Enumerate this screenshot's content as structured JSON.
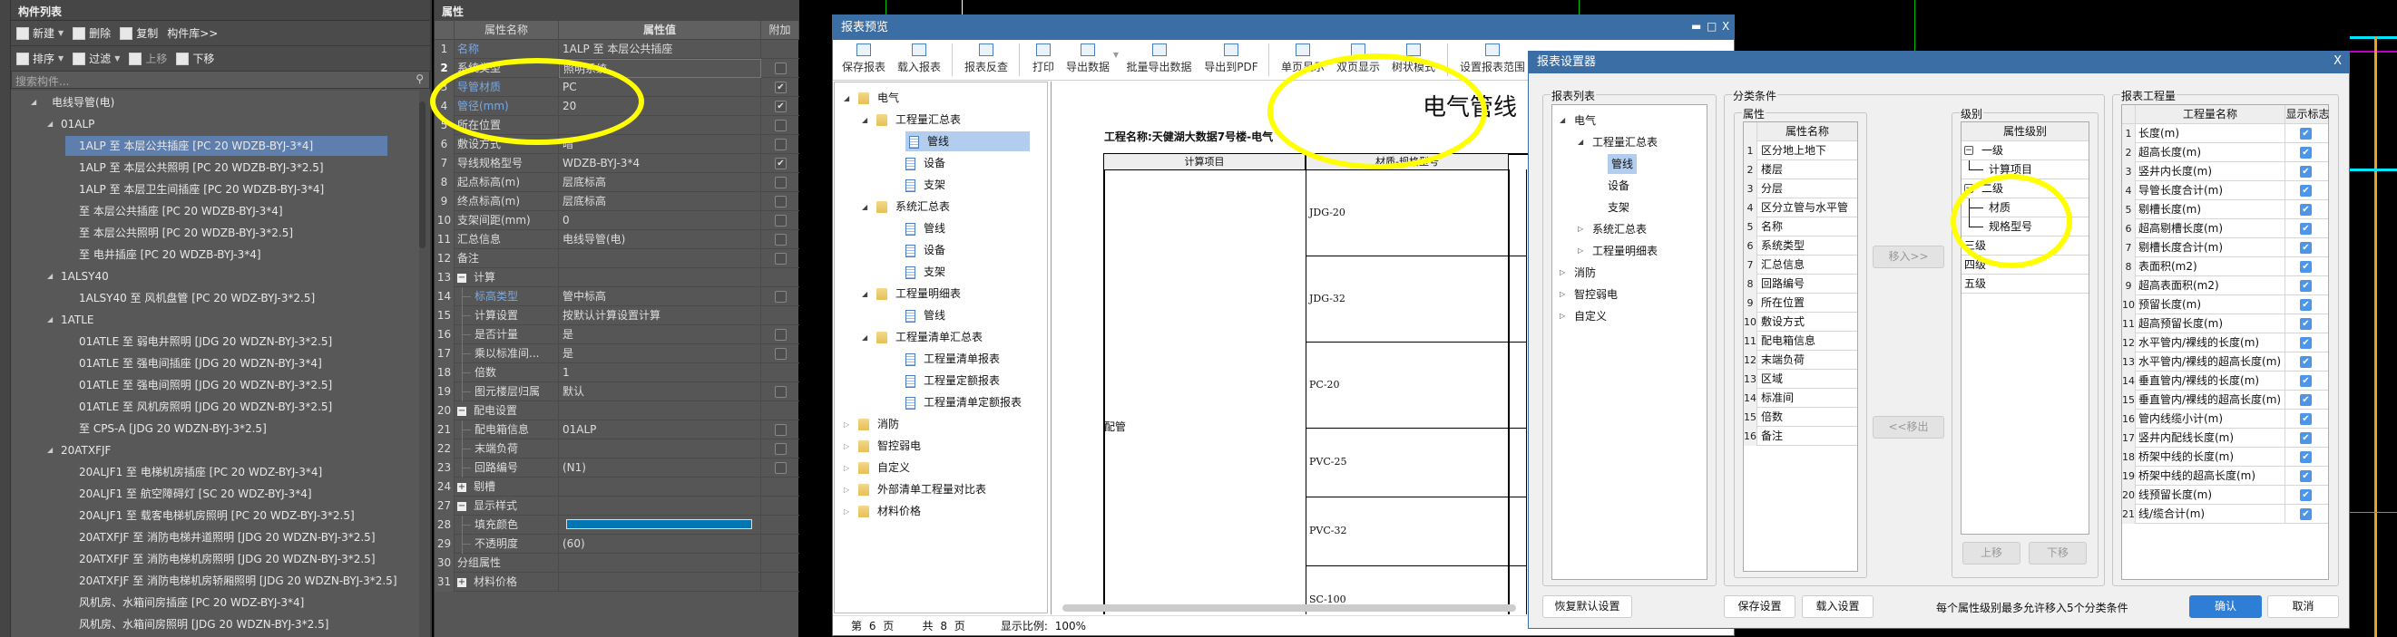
{
  "component_panel": {
    "title": "构件列表",
    "toolbar1": [
      {
        "label": "新建",
        "icon": "new-doc-icon",
        "dropdown": true
      },
      {
        "label": "删除",
        "icon": "delete-icon"
      },
      {
        "label": "复制",
        "icon": "copy-icon"
      },
      {
        "label": "构件库>>"
      }
    ],
    "toolbar2": [
      {
        "label": "排序",
        "icon": "sort-icon",
        "dropdown": true
      },
      {
        "label": "过滤",
        "icon": "filter-icon",
        "dropdown": true
      },
      {
        "label": "上移",
        "icon": "move-up-icon",
        "disabled": true
      },
      {
        "label": "下移",
        "icon": "move-down-icon"
      }
    ],
    "search_placeholder": "搜索构件...",
    "tree": [
      {
        "level": 0,
        "label": "电线导管(电)"
      },
      {
        "level": 1,
        "label": "01ALP"
      },
      {
        "level": 2,
        "label": "1ALP 至 本层公共插座 [PC 20 WDZB-BYJ-3*4]",
        "selected": true
      },
      {
        "level": 2,
        "label": "1ALP 至 本层公共照明 [PC 20 WDZB-BYJ-3*2.5]"
      },
      {
        "level": 2,
        "label": "1ALP 至 本层卫生间插座 [PC 20 WDZB-BYJ-3*4]"
      },
      {
        "level": 2,
        "label": "至 本层公共插座 [PC 20 WDZB-BYJ-3*4]"
      },
      {
        "level": 2,
        "label": "至 本层公共照明 [PC 20 WDZB-BYJ-3*2.5]"
      },
      {
        "level": 2,
        "label": "至 电井插座 [PC 20 WDZB-BYJ-3*4]"
      },
      {
        "level": 1,
        "label": "1ALSY40"
      },
      {
        "level": 2,
        "label": "1ALSY40 至 风机盘管 [PC 20 WDZ-BYJ-3*2.5]"
      },
      {
        "level": 1,
        "label": "1ATLE"
      },
      {
        "level": 2,
        "label": "01ATLE 至 弱电井照明 [JDG 20 WDZN-BYJ-3*2.5]"
      },
      {
        "level": 2,
        "label": "01ATLE 至 强电间插座 [JDG 20 WDZN-BYJ-3*4]"
      },
      {
        "level": 2,
        "label": "01ATLE 至 强电间照明 [JDG 20 WDZN-BYJ-3*2.5]"
      },
      {
        "level": 2,
        "label": "01ATLE 至 风机房照明 [JDG 20 WDZN-BYJ-3*2.5]"
      },
      {
        "level": 2,
        "label": "至 CPS-A [JDG 20 WDZN-BYJ-3*2.5]"
      },
      {
        "level": 1,
        "label": "20ATXFJF"
      },
      {
        "level": 2,
        "label": "20ALJF1 至 电梯机房插座 [PC 20 WDZ-BYJ-3*4]"
      },
      {
        "level": 2,
        "label": "20ALJF1 至 航空障碍灯 [SC 20 WDZ-BYJ-3*4]"
      },
      {
        "level": 2,
        "label": "20ALJF1 至 载客电梯机房照明 [PC 20 WDZ-BYJ-3*2.5]"
      },
      {
        "level": 2,
        "label": "20ATXFJF 至 消防电梯井道照明 [JDG 20 WDZN-BYJ-3*2.5]"
      },
      {
        "level": 2,
        "label": "20ATXFJF 至 消防电梯机房照明 [JDG 20 WDZN-BYJ-3*2.5]"
      },
      {
        "level": 2,
        "label": "20ATXFJF 至 消防电梯机房轿厢照明 [JDG 20 WDZN-BYJ-3*2.5]"
      },
      {
        "level": 2,
        "label": "风机房、水箱间房插座 [PC 20 WDZ-BYJ-3*4]"
      },
      {
        "level": 2,
        "label": "风机房、水箱间房照明 [JDG 20 WDZN-BYJ-3*2.5]"
      }
    ]
  },
  "properties": {
    "title": "属性",
    "headers": [
      "属性名称",
      "属性值",
      "附加"
    ],
    "fill_color": "#0077b3",
    "rows": [
      {
        "n": "1",
        "name": "名称",
        "value": "1ALP 至 本层公共插座",
        "blue": true,
        "check": null
      },
      {
        "n": "2",
        "name": "系统类型",
        "value": "照明系统",
        "check": false,
        "bold": true,
        "editing": true
      },
      {
        "n": "3",
        "name": "导管材质",
        "value": "PC",
        "blue": true,
        "check": true
      },
      {
        "n": "4",
        "name": "管径(mm)",
        "value": "20",
        "blue": true,
        "check": true
      },
      {
        "n": "5",
        "name": "所在位置",
        "value": "",
        "check": false
      },
      {
        "n": "6",
        "name": "敷设方式",
        "value": "暗",
        "check": false
      },
      {
        "n": "7",
        "name": "导线规格型号",
        "value": "WDZB-BYJ-3*4",
        "check": true
      },
      {
        "n": "8",
        "name": "起点标高(m)",
        "value": "层底标高",
        "check": false
      },
      {
        "n": "9",
        "name": "终点标高(m)",
        "value": "层底标高",
        "check": false
      },
      {
        "n": "10",
        "name": "支架间距(mm)",
        "value": "0",
        "check": false
      },
      {
        "n": "11",
        "name": "汇总信息",
        "value": "电线导管(电)",
        "check": false
      },
      {
        "n": "12",
        "name": "备注",
        "value": "",
        "check": false
      },
      {
        "n": "13",
        "name": "计算",
        "value": "",
        "group": "-",
        "check": null
      },
      {
        "n": "14",
        "name": "标高类型",
        "value": "管中标高",
        "child": true,
        "blue": true,
        "check": false
      },
      {
        "n": "15",
        "name": "计算设置",
        "value": "按默认计算设置计算",
        "child": true,
        "check": null
      },
      {
        "n": "16",
        "name": "是否计量",
        "value": "是",
        "child": true,
        "check": false
      },
      {
        "n": "17",
        "name": "乘以标准间...",
        "value": "是",
        "child": true,
        "check": false
      },
      {
        "n": "18",
        "name": "倍数",
        "value": "1",
        "child": true,
        "check": null
      },
      {
        "n": "19",
        "name": "图元楼层归属",
        "value": "默认",
        "child": true,
        "check": false
      },
      {
        "n": "20",
        "name": "配电设置",
        "value": "",
        "group": "-",
        "check": null
      },
      {
        "n": "21",
        "name": "配电箱信息",
        "value": "01ALP",
        "child": true,
        "check": false
      },
      {
        "n": "22",
        "name": "末端负荷",
        "value": "",
        "child": true,
        "check": false
      },
      {
        "n": "23",
        "name": "回路编号",
        "value": "(N1)",
        "child": true,
        "check": false
      },
      {
        "n": "24",
        "name": "剔槽",
        "value": "",
        "group": "+",
        "check": null
      },
      {
        "n": "27",
        "name": "显示样式",
        "value": "",
        "group": "-",
        "check": null
      },
      {
        "n": "28",
        "name": "填充颜色",
        "value": "",
        "child": true,
        "color": true,
        "check": null
      },
      {
        "n": "29",
        "name": "不透明度",
        "value": "(60)",
        "child": true,
        "check": null
      },
      {
        "n": "30",
        "name": "分组属性",
        "value": "",
        "check": null
      },
      {
        "n": "31",
        "name": "材料价格",
        "value": "",
        "group": "+",
        "check": null
      }
    ]
  },
  "preview": {
    "title": "报表预览",
    "toolbar": [
      {
        "label": "保存报表",
        "icon": "save-report-icon"
      },
      {
        "label": "载入报表",
        "icon": "load-report-icon"
      },
      {
        "label": "报表反查",
        "icon": "report-lookup-icon"
      },
      {
        "label": "打印",
        "icon": "print-icon"
      },
      {
        "label": "导出数据",
        "icon": "export-data-icon",
        "dropdown": true
      },
      {
        "label": "批量导出数据",
        "icon": "batch-export-icon"
      },
      {
        "label": "导出到PDF",
        "icon": "pdf-icon"
      },
      {
        "label": "单页显示",
        "icon": "single-page-icon"
      },
      {
        "label": "双页显示",
        "icon": "double-page-icon"
      },
      {
        "label": "树状模式",
        "icon": "tree-mode-icon"
      },
      {
        "label": "设置报表范围",
        "icon": "report-range-icon"
      }
    ],
    "tree": [
      {
        "level": 0,
        "label": "电气",
        "type": "folder",
        "open": true
      },
      {
        "level": 1,
        "label": "工程量汇总表",
        "type": "folder",
        "open": true
      },
      {
        "level": 2,
        "label": "管线",
        "type": "doc",
        "selected": true
      },
      {
        "level": 2,
        "label": "设备",
        "type": "doc"
      },
      {
        "level": 2,
        "label": "支架",
        "type": "doc"
      },
      {
        "level": 1,
        "label": "系统汇总表",
        "type": "folder",
        "open": true
      },
      {
        "level": 2,
        "label": "管线",
        "type": "doc"
      },
      {
        "level": 2,
        "label": "设备",
        "type": "doc"
      },
      {
        "level": 2,
        "label": "支架",
        "type": "doc"
      },
      {
        "level": 1,
        "label": "工程量明细表",
        "type": "folder",
        "open": true
      },
      {
        "level": 2,
        "label": "管线",
        "type": "doc"
      },
      {
        "level": 1,
        "label": "工程量清单汇总表",
        "type": "folder",
        "open": true
      },
      {
        "level": 2,
        "label": "工程量清单报表",
        "type": "doc"
      },
      {
        "level": 2,
        "label": "工程量定额报表",
        "type": "doc"
      },
      {
        "level": 2,
        "label": "工程量清单定额报表",
        "type": "doc"
      },
      {
        "level": 0,
        "label": "消防",
        "type": "folder",
        "open": false
      },
      {
        "level": 0,
        "label": "智控弱电",
        "type": "folder",
        "open": false
      },
      {
        "level": 0,
        "label": "自定义",
        "type": "folder",
        "open": false
      },
      {
        "level": 0,
        "label": "外部清单工程量对比表",
        "type": "folder",
        "open": false
      },
      {
        "level": 0,
        "label": "材料价格",
        "type": "folder",
        "open": false
      }
    ],
    "status": {
      "page_label": "第 6 页",
      "total_label": "共 8 页",
      "zoom_label": "显示比例: 100%"
    },
    "report": {
      "title": "电气管线",
      "project": "工程名称:天健湖大数据7号楼-电气",
      "headers": [
        "计算项目",
        "材质-规格型号"
      ],
      "category": "配管",
      "specs": [
        "JDG-20",
        "JDG-32",
        "PC-20",
        "PVC-25",
        "PVC-32",
        "SC-100"
      ]
    }
  },
  "setter": {
    "title": "报表设置器",
    "report_list_label": "报表列表",
    "report_tree": [
      {
        "level": 0,
        "label": "电气",
        "open": true
      },
      {
        "level": 1,
        "label": "工程量汇总表",
        "open": true
      },
      {
        "level": 2,
        "label": "管线",
        "selected": true
      },
      {
        "level": 2,
        "label": "设备"
      },
      {
        "level": 2,
        "label": "支架"
      },
      {
        "level": 1,
        "label": "系统汇总表",
        "open": false
      },
      {
        "level": 1,
        "label": "工程量明细表",
        "open": false
      },
      {
        "level": 0,
        "label": "消防",
        "open": false
      },
      {
        "level": 0,
        "label": "智控弱电",
        "open": false
      },
      {
        "level": 0,
        "label": "自定义",
        "open": false
      }
    ],
    "classify_label": "分类条件",
    "attr_label": "属性",
    "attr_header": "属性名称",
    "attrs": [
      "区分地上地下",
      "楼层",
      "分层",
      "区分立管与水平管",
      "名称",
      "系统类型",
      "汇总信息",
      "回路编号",
      "所在位置",
      "敷设方式",
      "配电箱信息",
      "末端负荷",
      "区域",
      "标准间",
      "倍数",
      "备注"
    ],
    "move_in": "移入>>",
    "move_out": "<<移出",
    "level_label": "级别",
    "level_header": "属性级别",
    "levels": [
      {
        "label": "一级",
        "expander": "-"
      },
      {
        "label": "计算项目",
        "child": true,
        "last": true
      },
      {
        "label": "二级",
        "expander": "-"
      },
      {
        "label": "材质",
        "child": true
      },
      {
        "label": "规格型号",
        "child": true,
        "last": true
      },
      {
        "label": "三级"
      },
      {
        "label": "四级"
      },
      {
        "label": "五级"
      }
    ],
    "up": "上移",
    "down": "下移",
    "quantity_label": "报表工程量",
    "quantity_headers": [
      "工程量名称",
      "显示标志"
    ],
    "quantities": [
      "长度(m)",
      "超高长度(m)",
      "竖井内长度(m)",
      "导管长度合计(m)",
      "剔槽长度(m)",
      "超高剔槽长度(m)",
      "剔槽长度合计(m)",
      "表面积(m2)",
      "超高表面积(m2)",
      "预留长度(m)",
      "超高预留长度(m)",
      "水平管内/裸线的长度(m)",
      "水平管内/裸线的超高长度(m)",
      "垂直管内/裸线的长度(m)",
      "垂直管内/裸线的超高长度(m)",
      "管内线缆小计(m)",
      "竖井内配线长度(m)",
      "桥架中线的长度(m)",
      "桥架中线的超高长度(m)",
      "线预留长度(m)",
      "线/缆合计(m)"
    ],
    "quantity_checked": true,
    "restore": "恢复默认设置",
    "save": "保存设置",
    "load": "载入设置",
    "hint": "每个属性级别最多允许移入5个分类条件",
    "ok": "确认",
    "cancel": "取消"
  },
  "colors": {
    "accent": "#3a6ea5",
    "selection_dark": "#5e7fae",
    "annotation": "#ffff00",
    "primary_button": "#2e7dd7"
  }
}
